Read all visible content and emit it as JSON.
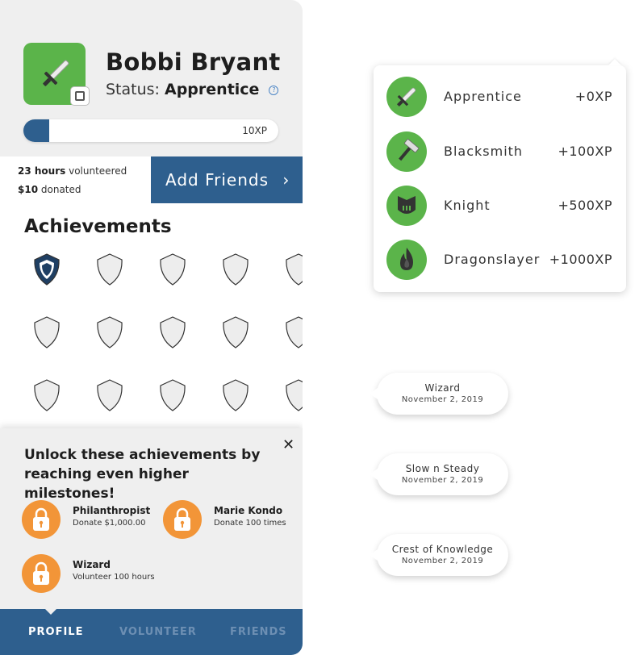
{
  "profile": {
    "name": "Bobbi Bryant",
    "status_label": "Status:",
    "status_value": "Apprentice",
    "xp_label": "10XP",
    "xp_progress_fraction": 0.1,
    "hours_value": "23 hours",
    "hours_suffix": "volunteered",
    "donated_value": "$10",
    "donated_suffix": "donated",
    "add_friends_label": "Add Friends",
    "achievements_title": "Achievements",
    "achievement_grid": {
      "rows": 3,
      "columns": 5,
      "earned_count": 1
    }
  },
  "unlock_sheet": {
    "title": "Unlock these achievements by reaching even higher milestones!",
    "items": [
      {
        "name": "Philanthropist",
        "desc": "Donate $1,000.00"
      },
      {
        "name": "Marie Kondo",
        "desc": "Donate 100 times"
      },
      {
        "name": "Wizard",
        "desc": "Volunteer 100 hours"
      }
    ]
  },
  "tabs": [
    {
      "label": "PROFILE",
      "active": true
    },
    {
      "label": "VOLUNTEER",
      "active": false
    },
    {
      "label": "FRIENDS",
      "active": false
    }
  ],
  "ranks": [
    {
      "name": "Apprentice",
      "xp": "+0XP",
      "icon": "sword-icon"
    },
    {
      "name": "Blacksmith",
      "xp": "+100XP",
      "icon": "hammer-icon"
    },
    {
      "name": "Knight",
      "xp": "+500XP",
      "icon": "helmet-icon"
    },
    {
      "name": "Dragonslayer",
      "xp": "+1000XP",
      "icon": "dragon-flame-icon"
    }
  ],
  "tooltips": [
    {
      "title": "Wizard",
      "date": "November 2, 2019"
    },
    {
      "title": "Slow n Steady",
      "date": "November 2, 2019"
    },
    {
      "title": "Crest of Knowledge",
      "date": "November 2, 2019"
    }
  ],
  "colors": {
    "brand_blue": "#2e5f8e",
    "rank_green": "#5bb44a",
    "lock_orange": "#f29538",
    "earned_shield": "#1f3f63"
  }
}
